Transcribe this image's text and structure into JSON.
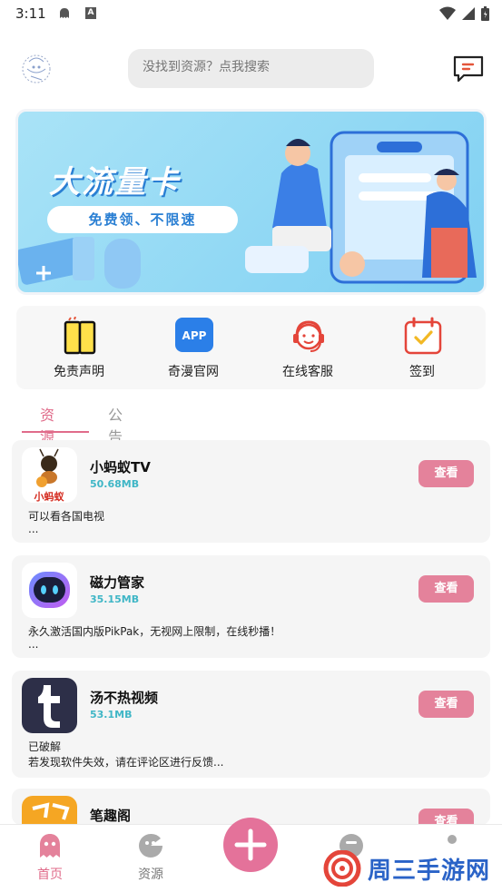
{
  "status_bar": {
    "time": "3:11",
    "a_badge": "A"
  },
  "header": {
    "search_placeholder": "没找到资源？点我搜索"
  },
  "banner": {
    "title": "大流量卡",
    "subtitle": "免费领、不限速"
  },
  "quick_links": [
    {
      "label": "免责声明",
      "icon": "book-icon"
    },
    {
      "label": "奇漫官网",
      "icon": "app-icon",
      "icon_text": "APP"
    },
    {
      "label": "在线客服",
      "icon": "headset-icon"
    },
    {
      "label": "签到",
      "icon": "calendar-check-icon"
    }
  ],
  "tabs": {
    "active": "资源",
    "inactive": "公告"
  },
  "resources": [
    {
      "name": "小蚂蚁TV",
      "size": "50.68MB",
      "button": "查看",
      "desc_line1": "可以看各国电视",
      "desc_line2": "...",
      "icon_text": "小蚂蚁"
    },
    {
      "name": "磁力管家",
      "size": "35.15MB",
      "button": "查看",
      "desc_line1": "永久激活国内版PikPak，无视网上限制，在线秒播！",
      "desc_line2": "..."
    },
    {
      "name": "汤不热视频",
      "size": "53.1MB",
      "button": "查看",
      "desc_line1": "已破解",
      "desc_line2": "若发现软件失效，请在评论区进行反馈..."
    },
    {
      "name": "笔趣阁",
      "size": "",
      "button": "查看",
      "desc_line1": "",
      "desc_line2": ""
    }
  ],
  "bottom_nav": {
    "home": "首页",
    "resources": "资源"
  },
  "watermark": {
    "text": "周三手游网"
  },
  "colors": {
    "accent": "#e4829b",
    "size_text": "#3fb6c6",
    "tab_active": "#e06b8a"
  }
}
